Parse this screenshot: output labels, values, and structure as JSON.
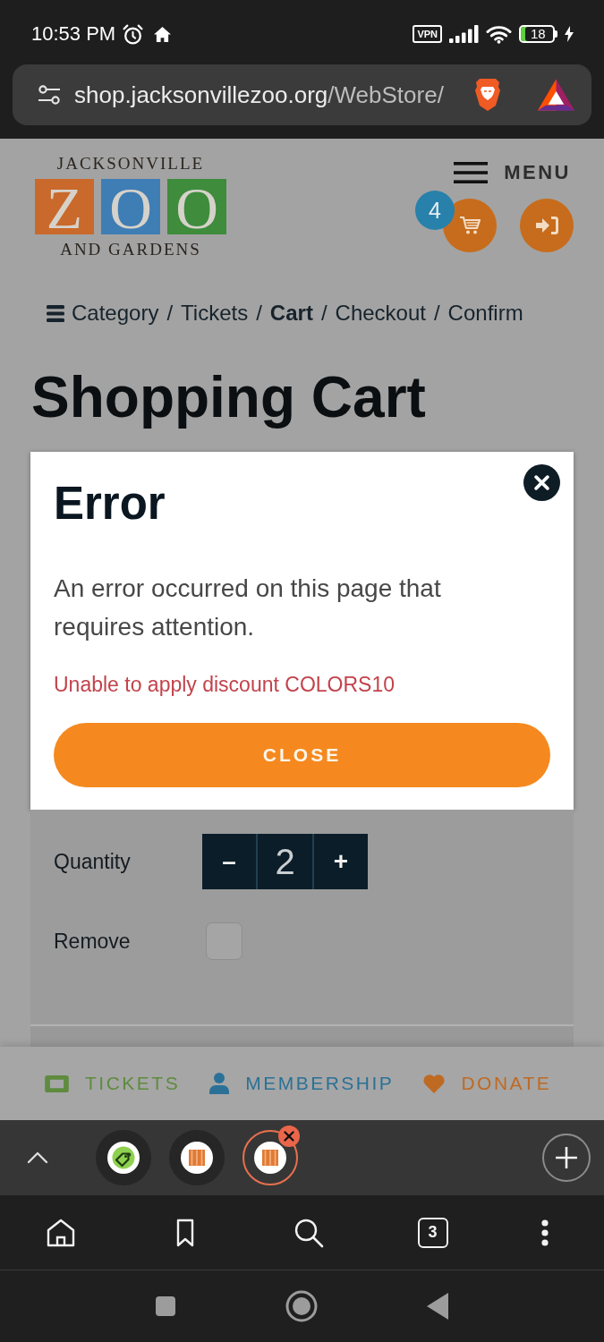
{
  "status_bar": {
    "time": "10:53 PM",
    "vpn": "VPN",
    "battery": "18"
  },
  "address_bar": {
    "host": "shop.jacksonvillezoo.org",
    "path": "/WebStore/"
  },
  "header": {
    "logo": {
      "top": "JACKSONVILLE",
      "tiles": [
        {
          "letter": "Z",
          "color": "#c9692b"
        },
        {
          "letter": "O",
          "color": "#3f7db5"
        },
        {
          "letter": "O",
          "color": "#3e8c3c"
        }
      ],
      "bottom": "AND GARDENS"
    },
    "menu": "MENU",
    "cart_count": "4"
  },
  "breadcrumb": {
    "separator": "/",
    "items": [
      {
        "label": "Category",
        "selected": false
      },
      {
        "label": "Tickets",
        "selected": false
      },
      {
        "label": "Cart",
        "selected": true
      },
      {
        "label": "Checkout",
        "selected": false
      },
      {
        "label": "Confirm",
        "selected": false
      }
    ]
  },
  "page_title": "Shopping Cart",
  "dialog": {
    "title": "Error",
    "message": "An error occurred on this page that requires attention.",
    "error": "Unable to apply discount COLORS10",
    "button": "CLOSE"
  },
  "cart_item": {
    "fields": [
      {
        "kind": "stepper",
        "label": "Quantity",
        "decrement": "–",
        "value": "2",
        "increment": "+"
      },
      {
        "kind": "checkbox",
        "label": "Remove",
        "checked": false
      }
    ]
  },
  "footer_nav": [
    {
      "kind": "tickets",
      "label": "TICKETS",
      "color": "#5e8b3e"
    },
    {
      "kind": "membership",
      "label": "MEMBERSHIP",
      "color": "#2b7197"
    },
    {
      "kind": "donate",
      "label": "DONATE",
      "color": "#bf6a23"
    }
  ],
  "browser_tabs": [
    {
      "kind": "tag",
      "selected": false
    },
    {
      "kind": "zoo",
      "selected": false
    },
    {
      "kind": "zoo",
      "selected": true
    }
  ],
  "toolbar": {
    "tab_count": "3"
  }
}
